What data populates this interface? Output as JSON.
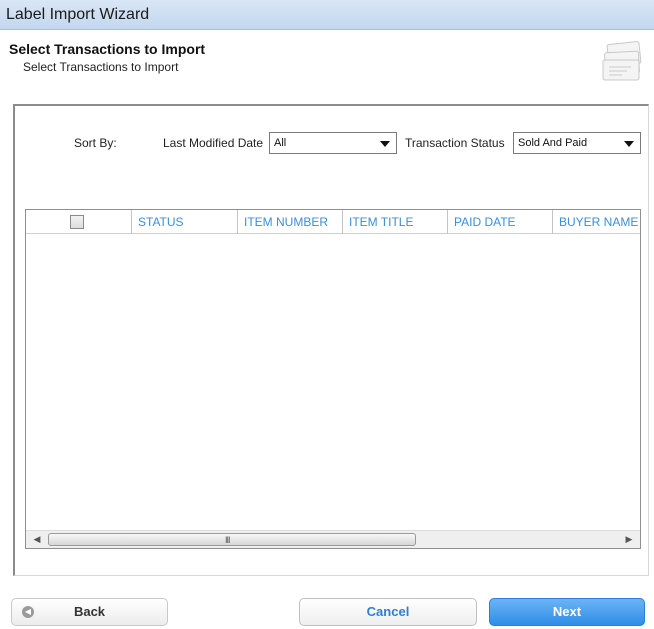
{
  "window": {
    "title": "Label Import Wizard"
  },
  "header": {
    "title": "Select Transactions to Import",
    "subtitle": "Select Transactions to Import",
    "icon": "document-stack-icon"
  },
  "filters": {
    "sort_by_label": "Sort By:",
    "last_modified_label": "Last Modified Date",
    "last_modified_value": "All",
    "transaction_status_label": "Transaction Status",
    "transaction_status_value": "Sold And Paid"
  },
  "table": {
    "columns": [
      "STATUS",
      "ITEM NUMBER",
      "ITEM TITLE",
      "PAID DATE",
      "BUYER NAME"
    ],
    "rows": [],
    "scroll_grip": "III"
  },
  "footer": {
    "back_label": "Back",
    "cancel_label": "Cancel",
    "next_label": "Next"
  },
  "colors": {
    "accent": "#3b8ed9",
    "next_button": "#2f8de6",
    "titlebar": "#c3d7ee"
  }
}
